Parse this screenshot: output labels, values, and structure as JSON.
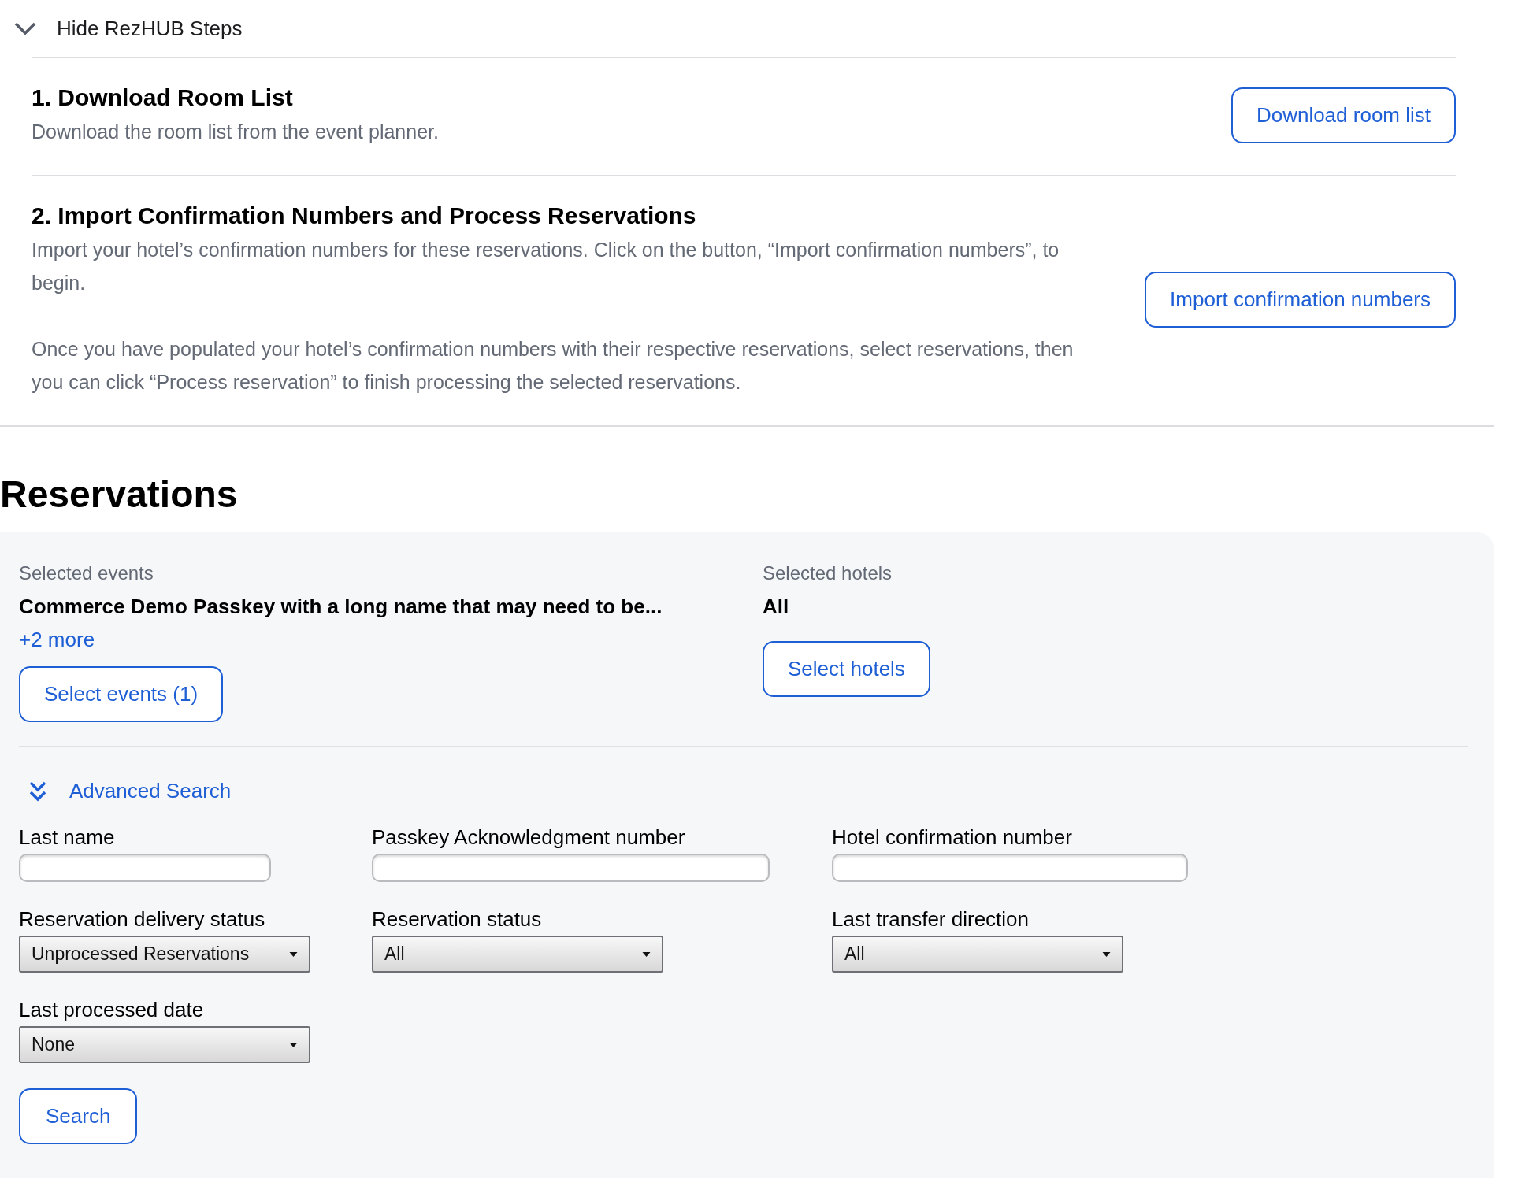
{
  "steps_toggle": {
    "label": "Hide RezHUB Steps",
    "expanded": true
  },
  "steps": [
    {
      "title": "1. Download Room List",
      "paragraphs": [
        "Download the room list from the event planner."
      ],
      "button": "Download room list"
    },
    {
      "title": "2. Import Confirmation Numbers and Process Reservations",
      "paragraphs": [
        "Import your hotel’s confirmation numbers for these reservations. Click on the button, “Import confirmation numbers”, to begin.",
        "Once you have populated your hotel’s confirmation numbers with their respective reservations, select reservations, then you can click “Process reservation” to finish processing the selected reservations."
      ],
      "button": "Import confirmation numbers"
    }
  ],
  "reservations": {
    "title": "Reservations",
    "selected_events": {
      "label": "Selected events",
      "value": "Commerce Demo Passkey with a long name that may need to be...",
      "more": "+2 more",
      "button": "Select events (1)"
    },
    "selected_hotels": {
      "label": "Selected hotels",
      "value": "All",
      "button": "Select hotels"
    },
    "advanced_search": {
      "label": "Advanced Search",
      "expanded": true
    },
    "field_rows": [
      [
        {
          "kind": "text",
          "label": "Last name"
        },
        {
          "kind": "text",
          "label": "Passkey Acknowledgment number"
        },
        {
          "kind": "text",
          "label": "Hotel confirmation number"
        }
      ],
      [
        {
          "kind": "select",
          "label": "Reservation delivery status",
          "value": "Unprocessed Reservations"
        },
        {
          "kind": "select",
          "label": "Reservation status",
          "value": "All"
        },
        {
          "kind": "select",
          "label": "Last transfer direction",
          "value": "All"
        }
      ],
      [
        {
          "kind": "select",
          "label": "Last processed date",
          "value": "None"
        }
      ]
    ],
    "search_button": "Search"
  }
}
